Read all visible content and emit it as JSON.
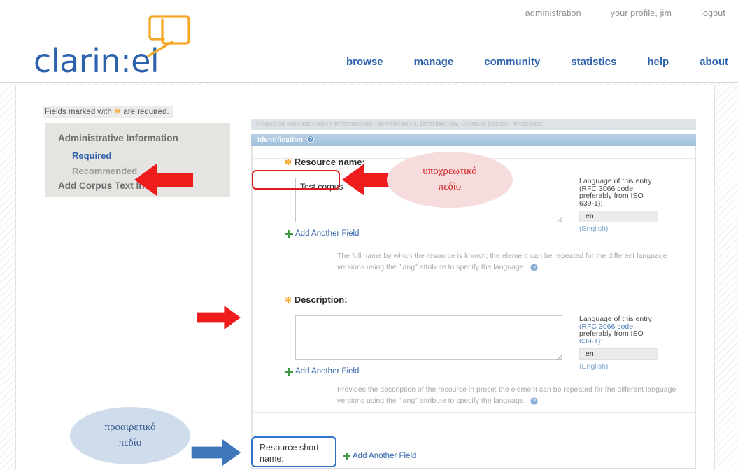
{
  "header": {
    "logo_text": "clarin:el",
    "logo_icon": "speech-bubble-icon",
    "utility_nav": [
      {
        "label": "administration"
      },
      {
        "label": "your profile, jim"
      },
      {
        "label": "logout"
      }
    ],
    "main_nav": [
      {
        "label": "browse"
      },
      {
        "label": "manage"
      },
      {
        "label": "community"
      },
      {
        "label": "statistics"
      },
      {
        "label": "help"
      },
      {
        "label": "about"
      }
    ]
  },
  "notice": {
    "prefix": "Fields marked with",
    "star": "✻",
    "suffix": "are required."
  },
  "sidebar": {
    "groups": [
      {
        "label": "Administrative Information"
      },
      {
        "label": "Add Corpus Text Info"
      }
    ],
    "sub_items": [
      {
        "label": "Required"
      },
      {
        "label": "Recommended"
      }
    ]
  },
  "main": {
    "panel_title": "Required administration information: Identification, Distribution, Contact person, Metadata",
    "section_header": "Identification",
    "section_help_icon": "question-mark-icon",
    "fields": {
      "resource_name": {
        "label": "Resource name:",
        "required_star": "✻",
        "value": "Test corpus",
        "add_another": "Add Another Field",
        "hint": "The full name by which the resource is known; the element can be repeated for the different language versions using the \"lang\" attribute to specify the language."
      },
      "description": {
        "label": "Description:",
        "required_star": "✻",
        "value": "",
        "add_another": "Add Another Field",
        "hint": "Provides the description of the resource in prose; the element can be repeated for the different language versions using the \"lang\" attribute to specify the language."
      },
      "resource_short_name": {
        "label": "Resource short name:",
        "add_another": "Add Another Field"
      }
    },
    "language_entry": {
      "line1": "Language of this entry",
      "line2": "(RFC 3066 code,",
      "line3": "preferably from ISO",
      "line4": "639-1):",
      "value": "en",
      "note": "(English)"
    }
  },
  "annotations": [
    {
      "id": "required-callout",
      "text_line1": "υποχρεωτικό",
      "text_line2": "πεδίο",
      "color": "#d02020"
    },
    {
      "id": "optional-callout",
      "text_line1": "προαιρετικό",
      "text_line2": "πεδίο",
      "color": "#36598f"
    }
  ],
  "colors": {
    "brand_blue": "#2f62ab",
    "logo_orange": "#f5a623",
    "annotation_red": "#e01b1b",
    "annotation_blue": "#2f75c7",
    "section_header_blue": "#9fc0dc"
  }
}
